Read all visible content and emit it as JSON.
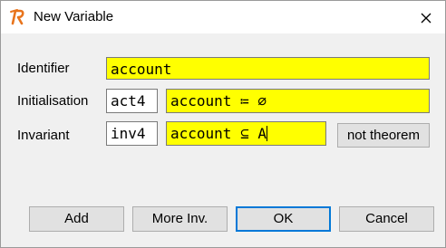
{
  "window": {
    "title": "New Variable",
    "app_icon": "rodin-r-icon",
    "close_icon": "close-icon"
  },
  "form": {
    "identifier": {
      "label": "Identifier",
      "value": "account"
    },
    "initialisation": {
      "label": "Initialisation",
      "name": "act4",
      "value": "account ≔ ∅"
    },
    "invariant": {
      "label": "Invariant",
      "name": "inv4",
      "value": "account ⊆ A",
      "theorem_toggle": "not theorem"
    }
  },
  "buttons": {
    "add": "Add",
    "more_inv": "More Inv.",
    "ok": "OK",
    "cancel": "Cancel"
  },
  "colors": {
    "field_highlight": "#ffff00",
    "dialog_bg": "#f0f0f0",
    "default_button_border": "#0078d7",
    "app_icon_color": "#e8741c"
  }
}
